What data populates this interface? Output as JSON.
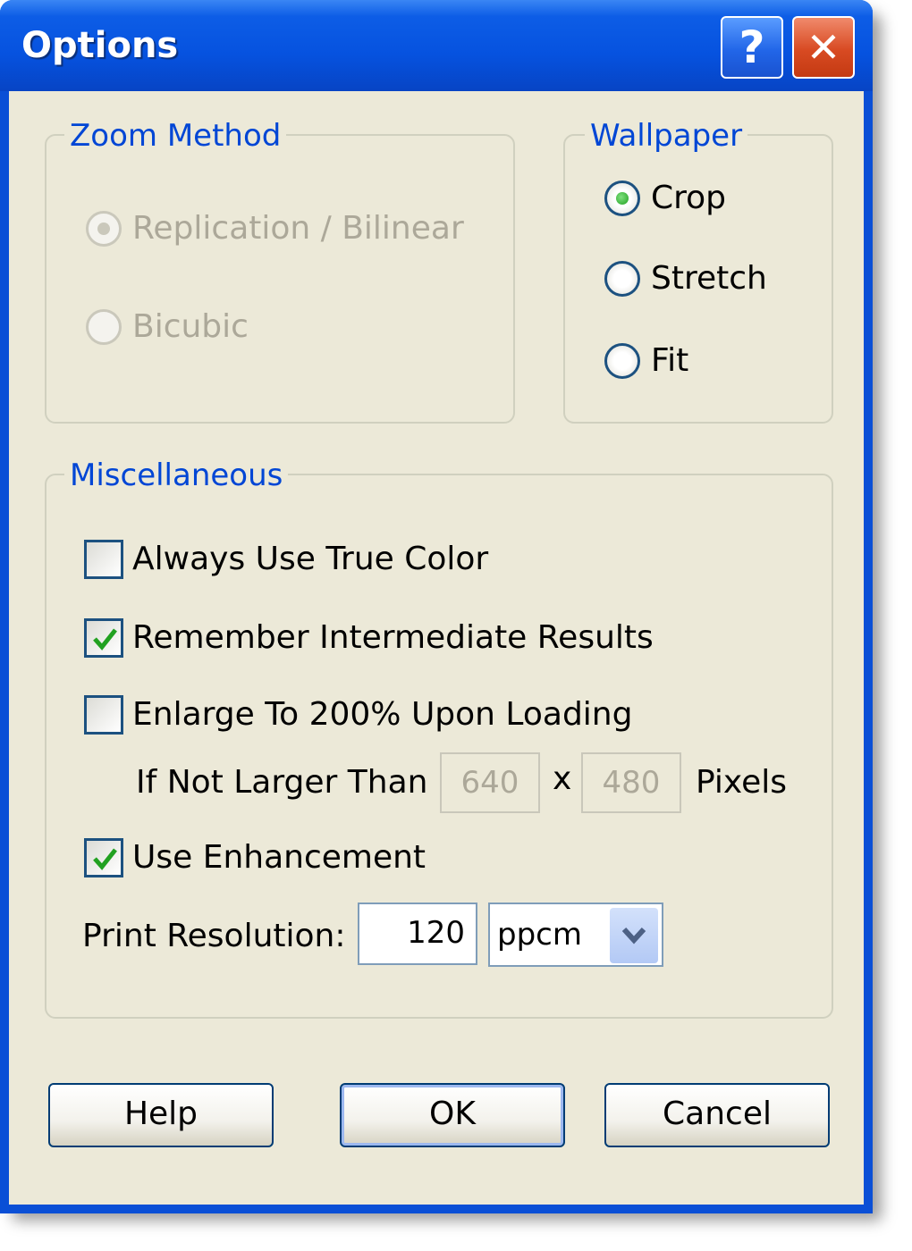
{
  "window": {
    "title": "Options",
    "help_glyph": "?",
    "close_glyph": "✕"
  },
  "zoom_method": {
    "legend": "Zoom Method",
    "options": [
      {
        "label": "Replication / Bilinear",
        "selected": true,
        "enabled": false
      },
      {
        "label": "Bicubic",
        "selected": false,
        "enabled": false
      }
    ]
  },
  "wallpaper": {
    "legend": "Wallpaper",
    "options": [
      {
        "label": "Crop",
        "selected": true
      },
      {
        "label": "Stretch",
        "selected": false
      },
      {
        "label": "Fit",
        "selected": false
      }
    ]
  },
  "misc": {
    "legend": "Miscellaneous",
    "always_true_color": {
      "label": "Always Use True Color",
      "checked": false
    },
    "remember_results": {
      "label": "Remember Intermediate Results",
      "checked": true
    },
    "enlarge": {
      "label": "Enlarge To 200% Upon Loading",
      "checked": false
    },
    "size_limit": {
      "label": "If Not Larger Than",
      "width": "640",
      "separator": "x",
      "height": "480",
      "unit": "Pixels"
    },
    "use_enhancement": {
      "label": "Use Enhancement",
      "checked": true
    },
    "print_resolution": {
      "label": "Print Resolution:",
      "value": "120",
      "unit_selected": "ppcm"
    }
  },
  "buttons": {
    "help": "Help",
    "ok": "OK",
    "cancel": "Cancel"
  },
  "colors": {
    "title_bar": "#0652df",
    "dialog_bg": "#ece9d8",
    "group_legend": "#0046d5",
    "check_green": "#21a121"
  }
}
